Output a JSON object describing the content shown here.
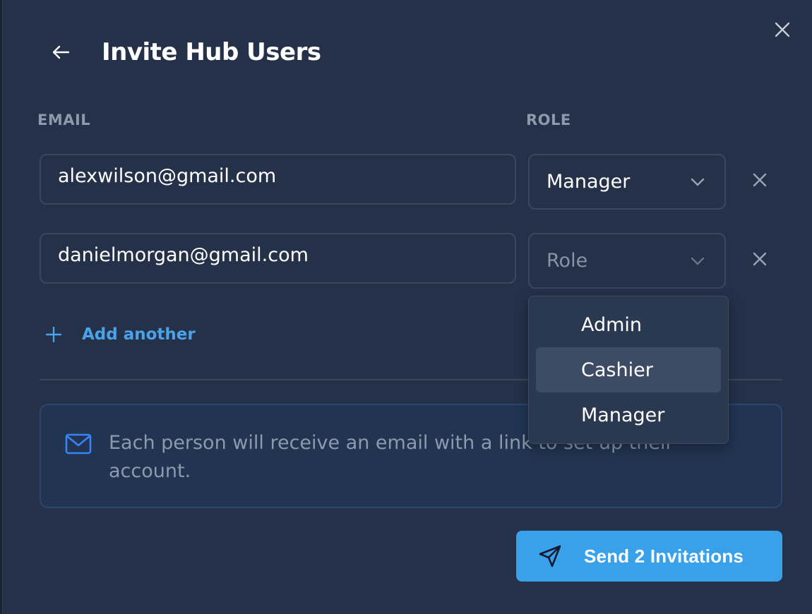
{
  "modal": {
    "title": "Invite Hub Users",
    "columns": {
      "email": "EMAIL",
      "role": "ROLE"
    },
    "rows": [
      {
        "email": "alexwilson@gmail.com",
        "role": "Manager",
        "role_placeholder": "Role"
      },
      {
        "email": "danielmorgan@gmail.com",
        "role": "",
        "role_placeholder": "Role"
      }
    ],
    "add_another_label": "Add another",
    "info_text": "Each person will receive an email with a link to set up their account.",
    "send_button_label": "Send 2 Invitations"
  },
  "role_dropdown": {
    "open": true,
    "options": [
      "Admin",
      "Cashier",
      "Manager"
    ],
    "highlighted": "Cashier"
  },
  "colors": {
    "background": "#243149",
    "accent": "#39a0ea",
    "link": "#4aa3e8",
    "muted_text": "#8d99ad",
    "info_icon": "#3b82f6"
  },
  "icons": {
    "close": "close-icon",
    "back": "arrow-left-icon",
    "chevron": "chevron-down-icon",
    "remove": "x-icon",
    "add": "plus-icon",
    "info": "mail-icon",
    "send": "send-icon"
  }
}
